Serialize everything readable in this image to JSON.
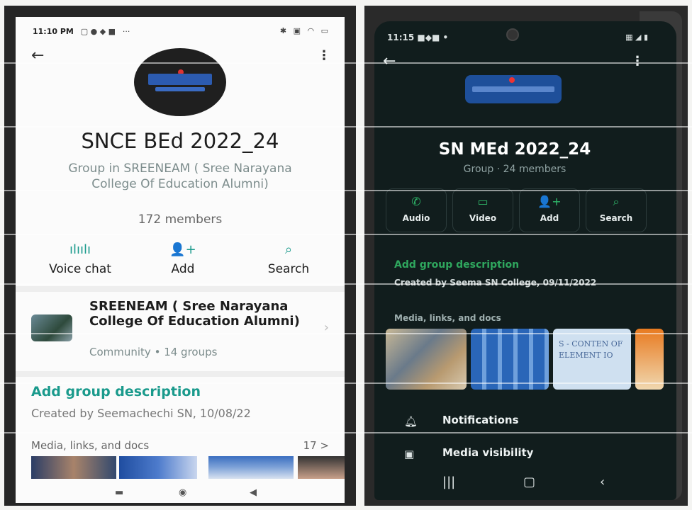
{
  "left": {
    "status": {
      "time": "11:10 PM",
      "more": "···"
    },
    "title": "SNCE BEd 2022_24",
    "subtitle": "Group in SREENEAM ( Sree Narayana College Of Education Alumni)",
    "members": "172 members",
    "actions": [
      {
        "label": "Voice chat",
        "icon": "voice-chat-icon"
      },
      {
        "label": "Add",
        "icon": "add-person-icon"
      },
      {
        "label": "Search",
        "icon": "search-icon"
      }
    ],
    "community": {
      "name": "SREENEAM ( Sree Narayana College Of Education Alumni)",
      "sub": "Community • 14 groups"
    },
    "add_description": "Add group description",
    "created": "Created by Seemachechi SN, 10/08/22",
    "media_label": "Media, links, and docs",
    "media_count": "17 >"
  },
  "right": {
    "status": {
      "time": "11:15"
    },
    "title": "SN MEd 2022_24",
    "subtitle": "Group · 24 members",
    "actions": [
      {
        "label": "Audio",
        "icon": "phone-icon"
      },
      {
        "label": "Video",
        "icon": "video-icon"
      },
      {
        "label": "Add",
        "icon": "add-person-icon"
      },
      {
        "label": "Search",
        "icon": "search-icon"
      }
    ],
    "add_description": "Add group description",
    "created": "Created by Seema SN College, 09/11/2022",
    "media_label": "Media, links, and docs",
    "thumb_text": "S - CONTEN OF ELEMENT IO",
    "rows": [
      {
        "label": "Notifications",
        "icon": "bell-icon"
      },
      {
        "label": "Media visibility",
        "icon": "image-icon"
      }
    ]
  },
  "colors": {
    "teal": "#1a9a8c",
    "green": "#2fb86a",
    "dark_bg": "#111d1d"
  }
}
